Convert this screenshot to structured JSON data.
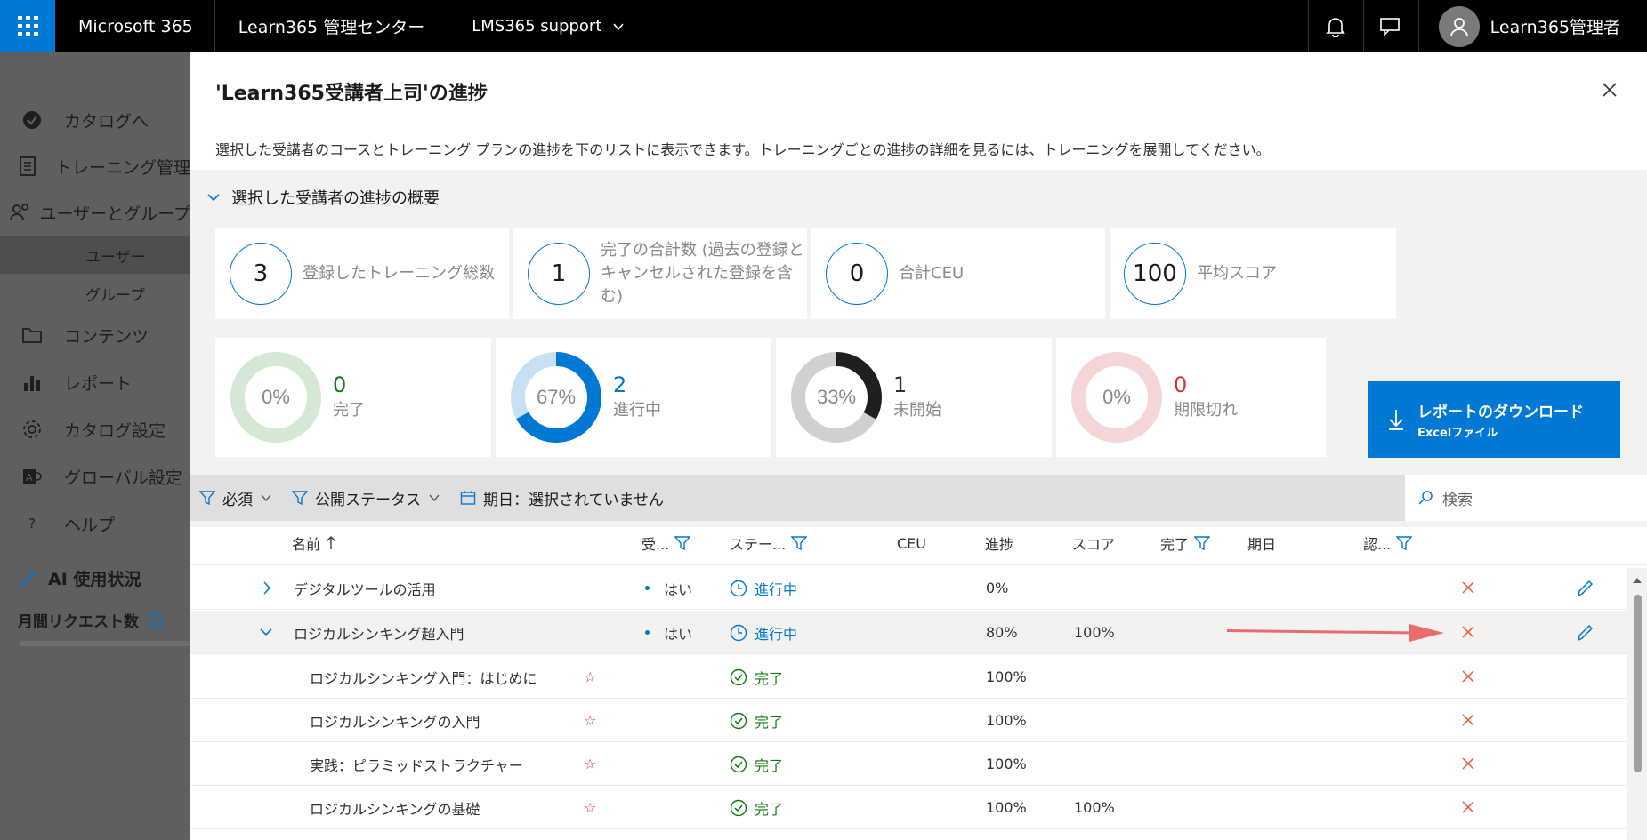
{
  "topbar": {
    "brand": "Microsoft 365",
    "app_title": "Learn365 管理センター",
    "org": "LMS365 support",
    "user_name": "Learn365管理者"
  },
  "sidebar": {
    "items": [
      {
        "label": "カタログへ",
        "icon": "catalog-check-icon"
      },
      {
        "label": "トレーニング管理",
        "icon": "training-icon"
      },
      {
        "label": "ユーザーとグループ",
        "icon": "users-icon"
      },
      {
        "label": "コンテンツ",
        "icon": "folder-icon"
      },
      {
        "label": "レポート",
        "icon": "chart-icon"
      },
      {
        "label": "カタログ設定",
        "icon": "gear-icon"
      },
      {
        "label": "グローバル設定",
        "icon": "global-settings-icon"
      },
      {
        "label": "ヘルプ",
        "icon": "help-icon"
      }
    ],
    "subitems": [
      {
        "label": "ユーザー",
        "active": true
      },
      {
        "label": "グループ",
        "active": false
      }
    ],
    "ai_title": "AI 使用状況",
    "request_title": "月間リクエスト数"
  },
  "panel": {
    "title": "'Learn365受講者上司'の進捗",
    "description": "選択した受講者のコースとトレーニング プランの進捗を下のリストに表示できます。トレーニングごとの進捗の詳細を見るには、トレーニングを展開してください。",
    "summary_header": "選択した受講者の進捗の概要",
    "stats": [
      {
        "value": "3",
        "label": "登録したトレーニング総数"
      },
      {
        "value": "1",
        "label": "完了の合計数 (過去の登録とキャンセルされた登録を含む)"
      },
      {
        "value": "0",
        "label": "合計CEU"
      },
      {
        "value": "100",
        "label": "平均スコア"
      }
    ],
    "donuts": [
      {
        "percent_text": "0%",
        "count": "0",
        "label": "完了",
        "fraction": 0.0,
        "color": "#107c10",
        "track": "#d4e8d4"
      },
      {
        "percent_text": "67%",
        "count": "2",
        "label": "進行中",
        "fraction": 0.67,
        "color": "#0078d4",
        "track": "#c7e0f4"
      },
      {
        "percent_text": "33%",
        "count": "1",
        "label": "未開始",
        "fraction": 0.33,
        "color": "#201f1e",
        "track": "#d2d0ce"
      },
      {
        "percent_text": "0%",
        "count": "0",
        "label": "期限切れ",
        "fraction": 0.0,
        "color": "#d13438",
        "track": "#f5d6d7"
      }
    ],
    "download": {
      "label": "レポートのダウンロード",
      "sublabel": "Excelファイル"
    }
  },
  "filters": {
    "required": "必須",
    "publish_status": "公開ステータス",
    "due_date": "期日：選択されていません",
    "search_placeholder": "検索"
  },
  "table": {
    "headers": {
      "name": "名前",
      "enrolled": "受...",
      "status": "ステー...",
      "ceu": "CEU",
      "progress": "進捗",
      "score": "スコア",
      "complete": "完了",
      "due": "期日",
      "cert": "認..."
    },
    "rows": [
      {
        "name": "デジタルツールの活用",
        "enrolled": "はい",
        "status": "進行中",
        "progress": "0%",
        "score": "",
        "expand": "collapsed",
        "level": 0
      },
      {
        "name": "ロジカルシンキング超入門",
        "enrolled": "はい",
        "status": "進行中",
        "progress": "80%",
        "score": "100%",
        "expand": "expanded",
        "level": 0
      },
      {
        "name": "ロジカルシンキング入門：はじめに",
        "enrolled": "",
        "status": "完了",
        "progress": "100%",
        "score": "",
        "level": 1
      },
      {
        "name": "ロジカルシンキングの入門",
        "enrolled": "",
        "status": "完了",
        "progress": "100%",
        "score": "",
        "level": 1
      },
      {
        "name": "実践：ピラミッドストラクチャー",
        "enrolled": "",
        "status": "完了",
        "progress": "100%",
        "score": "",
        "level": 1
      },
      {
        "name": "ロジカルシンキングの基礎",
        "enrolled": "",
        "status": "完了",
        "progress": "100%",
        "score": "100%",
        "level": 1
      }
    ]
  }
}
